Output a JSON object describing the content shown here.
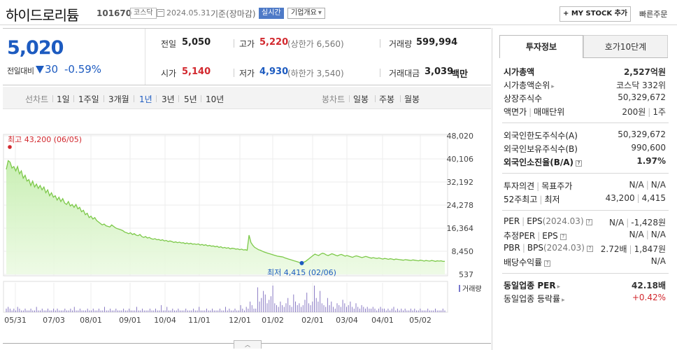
{
  "header": {
    "stock_name": "하이드로리튬",
    "stock_code": "101670",
    "market": "코스닥",
    "date": "2024.05.31",
    "basis": "기준(장마감)",
    "realtime": "실시간",
    "company_info": "기업개요",
    "mystock_button": "MY STOCK 추가",
    "quick_order": "빠른주문"
  },
  "price": {
    "current": "5,020",
    "compare_label": "전일대비",
    "change": "30",
    "change_pct": "-0.59%",
    "prev_label": "전일",
    "prev": "5,050",
    "high_label": "고가",
    "high": "5,220",
    "upper_limit": "(상한가 6,560)",
    "volume_label": "거래량",
    "volume": "599,994",
    "open_label": "시가",
    "open": "5,140",
    "low_label": "저가",
    "low": "4,930",
    "lower_limit": "(하한가 3,540)",
    "amount_label": "거래대금",
    "amount": "3,039",
    "amount_unit": "백만"
  },
  "period_bar": {
    "line_label": "선차트",
    "line_items": [
      "1일",
      "1주일",
      "3개월",
      "1년",
      "3년",
      "5년",
      "10년"
    ],
    "active_index": 3,
    "candle_label": "봉차트",
    "candle_items": [
      "일봉",
      "주봉",
      "월봉"
    ]
  },
  "chart_data": {
    "type": "area",
    "y_ticks": [
      "48,020",
      "40,106",
      "32,192",
      "24,278",
      "16,364",
      "8,450",
      "537"
    ],
    "ylim": [
      537,
      48020
    ],
    "x_ticks": [
      "05/31",
      "07/03",
      "08/01",
      "09/01",
      "10/04",
      "11/01",
      "12/01",
      "01/02",
      "02/01",
      "03/04",
      "04/01",
      "05/02"
    ],
    "high_annotation": "최고 43,200 (06/05)",
    "low_annotation": "최저 4,415 (02/06)",
    "high_value": 43200,
    "low_value": 4415,
    "volume_label": "거래량",
    "series": [
      {
        "values": [
          36500,
          39500,
          39000,
          37000,
          37500,
          36000,
          37500,
          35000,
          36000,
          33500,
          34500,
          32500,
          33000,
          31000,
          32500,
          30500,
          31500,
          30000,
          31000,
          29500,
          30500,
          28500,
          29500,
          27500,
          28500,
          27000,
          27500,
          26000,
          27000,
          25500,
          26500,
          25000,
          24500,
          25500,
          24000,
          24500,
          23500,
          24500,
          23000,
          23500,
          22000,
          22500,
          21000,
          21500,
          20000,
          20500,
          19500,
          20000,
          19000,
          18500,
          18000,
          17500,
          17800,
          17200,
          17000,
          16800,
          17500,
          17000,
          16500,
          16200,
          16000,
          15800,
          15500,
          15000,
          14800,
          14500,
          14800,
          14200,
          14500,
          14000,
          13800,
          14200,
          13500,
          13200,
          13500,
          13000,
          13200,
          12800,
          12600,
          12800,
          12400,
          12500,
          12200,
          12400,
          12000,
          12200,
          11800,
          12000,
          11800,
          11500,
          11700,
          11400,
          11600,
          11300,
          11400,
          11100,
          11300,
          11000,
          11200,
          10900,
          11000,
          10800,
          11000,
          10600,
          10800,
          10500,
          10700,
          10300,
          10500,
          10200,
          10300,
          10000,
          10200,
          9800,
          10000,
          9600,
          9800,
          9500,
          9700,
          9300,
          9500,
          9400,
          9200,
          9300,
          9000,
          9200,
          8900,
          9000,
          8800,
          14000,
          11500,
          10500,
          9800,
          9400,
          9000,
          8800,
          8500,
          8200,
          8000,
          7800,
          7600,
          7400,
          7200,
          7000,
          6800,
          6700,
          6600,
          6500,
          6200,
          6000,
          5800,
          5600,
          5400,
          5200,
          5000,
          4800,
          4600,
          4415,
          4700,
          5000,
          5500,
          6000,
          6500,
          7000,
          7500,
          7200,
          7000,
          7500,
          7800,
          7600,
          7200,
          7000,
          7300,
          7600,
          7400,
          7100,
          6900,
          7200,
          7400,
          7100,
          6800,
          7000,
          6800,
          6600,
          6400,
          6700,
          6900,
          6700,
          6500,
          6300,
          6500,
          6700,
          6500,
          6300,
          6100,
          6300,
          6100,
          6000,
          6200,
          6000,
          5800,
          6000,
          5900,
          5700,
          5900,
          5800,
          5600,
          5800,
          5700,
          5600,
          5500,
          5400,
          5600,
          5500,
          5400,
          5300,
          5500,
          5400,
          5300,
          5200,
          5400,
          5300,
          5100,
          5300,
          5200,
          5100,
          5300,
          5200,
          5000,
          5200,
          5100,
          5200,
          5000,
          5020
        ]
      }
    ],
    "volume": [
      2,
      3,
      2,
      1,
      2,
      1,
      3,
      2,
      1,
      1,
      2,
      1,
      1,
      2,
      1,
      1,
      3,
      1,
      1,
      2,
      1,
      1,
      2,
      1,
      1,
      2,
      1,
      2,
      1,
      1,
      1,
      2,
      1,
      1,
      2,
      1,
      3,
      1,
      1,
      2,
      1,
      1,
      1,
      2,
      1,
      1,
      2,
      1,
      1,
      2,
      1,
      1,
      3,
      1,
      1,
      2,
      1,
      1,
      2,
      1,
      1,
      1,
      2,
      1,
      1,
      2,
      1,
      1,
      1,
      3,
      1,
      1,
      2,
      1,
      1,
      1,
      2,
      1,
      1,
      2,
      1,
      1,
      4,
      1,
      1,
      3,
      1,
      1,
      2,
      1,
      1,
      2,
      1,
      1,
      1,
      2,
      1,
      1,
      1,
      2,
      1,
      1,
      3,
      1,
      1,
      1,
      2,
      1,
      1,
      2,
      1,
      1,
      1,
      2,
      1,
      1,
      3,
      1,
      2,
      1,
      1,
      2,
      1,
      1,
      4,
      2,
      1,
      3,
      2,
      6,
      4,
      2,
      2,
      14,
      6,
      8,
      12,
      10,
      5,
      7,
      9,
      15,
      5,
      4,
      3,
      6,
      4,
      3,
      5,
      8,
      4,
      3,
      10,
      6,
      4,
      5,
      3,
      4,
      7,
      11,
      5,
      4,
      6,
      15,
      8,
      6,
      12,
      5,
      4,
      3,
      8,
      4,
      6,
      3,
      2,
      5,
      4,
      3,
      7,
      5,
      3,
      4,
      6,
      3,
      2,
      5,
      3,
      2,
      4,
      3,
      2,
      3,
      2,
      2,
      3,
      2,
      1,
      2,
      3,
      2,
      2,
      1,
      2,
      1,
      2,
      3,
      1,
      2,
      1,
      2,
      1,
      2,
      1,
      1,
      2,
      1,
      2,
      1,
      1,
      2,
      1,
      1,
      1,
      2,
      1,
      1,
      1,
      2,
      1,
      1,
      1,
      2,
      1
    ]
  },
  "sidebar": {
    "tab_active": "투자정보",
    "tab_other": "호가10단계",
    "market_cap_label": "시가총액",
    "market_cap": "2,527억원",
    "cap_rank_label": "시가총액순위",
    "cap_rank": "코스닥 332위",
    "shares_label": "상장주식수",
    "shares": "50,329,672",
    "face_label": "액면가",
    "unit_label": "매매단위",
    "face": "200원",
    "unit": "1주",
    "foreign_limit_label": "외국인한도주식수(A)",
    "foreign_limit": "50,329,672",
    "foreign_hold_label": "외국인보유주식수(B)",
    "foreign_hold": "990,600",
    "foreign_ratio_label": "외국인소진율(B/A)",
    "foreign_ratio": "1.97%",
    "opinion_label": "투자의견",
    "target_label": "목표주가",
    "opinion": "N/A",
    "target": "N/A",
    "w52_label": "52주최고",
    "w52_low_label": "최저",
    "w52_high": "43,200",
    "w52_low": "4,415",
    "per_label": "PER",
    "eps_label": "EPS",
    "per_period": "(2024.03)",
    "per": "N/A",
    "eps": "-1,428원",
    "est_per_label": "추정PER",
    "est_eps_label": "EPS",
    "est_per": "N/A",
    "est_eps": "N/A",
    "pbr_label": "PBR",
    "bps_label": "BPS",
    "bps_period": "(2024.03)",
    "pbr": "2.72배",
    "bps": "1,847원",
    "div_label": "배당수익률",
    "div": "N/A",
    "sector_per_label": "동일업종 PER",
    "sector_per": "42.18배",
    "sector_chg_label": "동일업종 등락률",
    "sector_chg": "+0.42%"
  },
  "colors": {
    "up": "#d2282e",
    "down": "#1d5bc0",
    "line": "#7dc94a"
  }
}
